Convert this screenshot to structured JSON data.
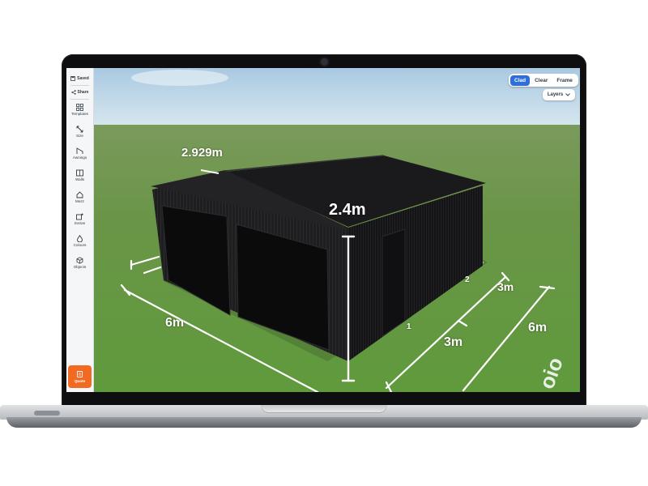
{
  "sidebar": {
    "saved_label": "Saved",
    "share_label": "Share",
    "items": [
      {
        "label": "Templates"
      },
      {
        "label": "Size"
      },
      {
        "label": "Awnings"
      },
      {
        "label": "Walls"
      },
      {
        "label": "Mezz"
      },
      {
        "label": "Extras"
      },
      {
        "label": "Colours"
      },
      {
        "label": "Objects"
      }
    ],
    "quote_label": "Quote"
  },
  "view_toggle": {
    "options": [
      "Clad",
      "Clear",
      "Frame"
    ],
    "selected": "Clad"
  },
  "layers_label": "Layers",
  "dimensions": {
    "roof_pitch_length": "2.929m",
    "wall_height": "2.4m",
    "front_width": "6m",
    "side_length_total": "6m",
    "bay_1": "3m",
    "bay_2": "3m",
    "bay_markers": [
      "1",
      "2"
    ]
  },
  "colors": {
    "accent": "#2f6fdc",
    "quote_button": "#f26a22",
    "shed": "#1b1b1d",
    "grass": "#6a9a4a",
    "sky": "#b9d4e8"
  }
}
